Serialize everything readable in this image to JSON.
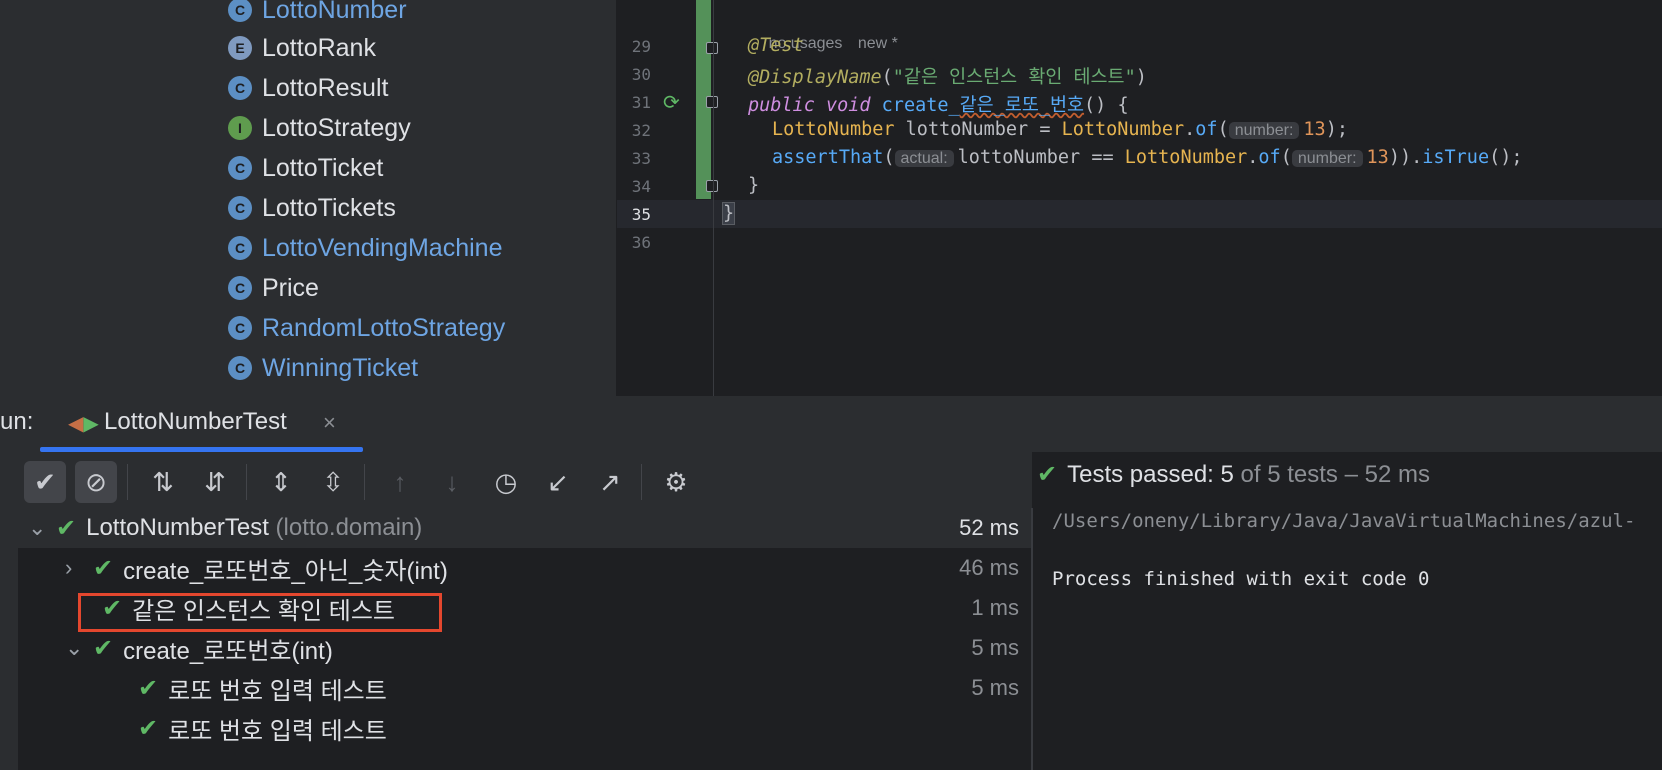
{
  "project_tree": {
    "items": [
      {
        "label": "LottoNumber",
        "kind": "C",
        "modified": true
      },
      {
        "label": "LottoRank",
        "kind": "E",
        "modified": false
      },
      {
        "label": "LottoResult",
        "kind": "C",
        "modified": false
      },
      {
        "label": "LottoStrategy",
        "kind": "I",
        "modified": false
      },
      {
        "label": "LottoTicket",
        "kind": "C",
        "modified": false
      },
      {
        "label": "LottoTickets",
        "kind": "C",
        "modified": false
      },
      {
        "label": "LottoVendingMachine",
        "kind": "C",
        "modified": true
      },
      {
        "label": "Price",
        "kind": "C",
        "modified": false
      },
      {
        "label": "RandomLottoStrategy",
        "kind": "C",
        "modified": true
      },
      {
        "label": "WinningTicket",
        "kind": "C",
        "modified": true
      }
    ]
  },
  "editor": {
    "hint_usages": "no usages",
    "hint_new": "new *",
    "line_numbers": [
      "29",
      "30",
      "31",
      "32",
      "33",
      "34",
      "35",
      "36"
    ],
    "code": {
      "l29_annotation": "@Test",
      "l30_annotation": "@DisplayName",
      "l30_open": "(",
      "l30_string": "\"같은 인스턴스 확인 테스트\"",
      "l30_close": ")",
      "l31_public": "public",
      "l31_void": "void",
      "l31_name_prefix": "create_",
      "l31_name_korean": "같은_로또_번호",
      "l31_rest": "() {",
      "l32_type": "LottoNumber",
      "l32_var": " lottoNumber = ",
      "l32_cls": "LottoNumber",
      "l32_dot": ".",
      "l32_method": "of",
      "l32_open": "(",
      "l32_hint": "number:",
      "l32_num": "13",
      "l32_close": ");",
      "l33_method": "assertThat",
      "l33_open": "(",
      "l33_hint": "actual:",
      "l33_expr": "lottoNumber == ",
      "l33_cls": "LottoNumber",
      "l33_dot": ".",
      "l33_of": "of",
      "l33_open2": "(",
      "l33_hint2": "number:",
      "l33_num": "13",
      "l33_close": "))",
      "l33_dot2": ".",
      "l33_istrue": "isTrue",
      "l33_end": "();",
      "l34": "}",
      "l35": "}"
    }
  },
  "run_panel": {
    "label": "un:",
    "tab_title": "LottoNumberTest",
    "close_glyph": "×",
    "status_prefix": "Tests passed: 5",
    "status_suffix": "of 5 tests – 52 ms",
    "tree": [
      {
        "label": "LottoNumberTest",
        "suffix": "(lotto.domain)",
        "time": "52 ms"
      },
      {
        "label": "create_로또번호_아닌_숫자(int)",
        "time": "46 ms"
      },
      {
        "label": "같은 인스턴스 확인 테스트",
        "time": "1 ms"
      },
      {
        "label": "create_로또번호(int)",
        "time": "5 ms"
      },
      {
        "label": "로또 번호 입력 테스트",
        "time": "5 ms"
      },
      {
        "label": "로또 번호 입력 테스트",
        "time": ""
      }
    ],
    "console": {
      "path": "/Users/oneny/Library/Java/JavaVirtualMachines/azul-",
      "exit": "Process finished with exit code 0"
    }
  },
  "colors": {
    "pass_green": "#5fb865",
    "highlight_red": "#e4472e",
    "tab_underline": "#3574f0",
    "change_bar": "#549159"
  },
  "icons": [
    "run-test-gutter-icon",
    "show-passed-icon",
    "show-ignored-icon",
    "sort-alpha-icon",
    "sort-duration-icon",
    "expand-all-icon",
    "collapse-all-icon",
    "prev-failed-icon",
    "next-failed-icon",
    "history-icon",
    "import-tests-icon",
    "export-tests-icon",
    "settings-icon"
  ]
}
